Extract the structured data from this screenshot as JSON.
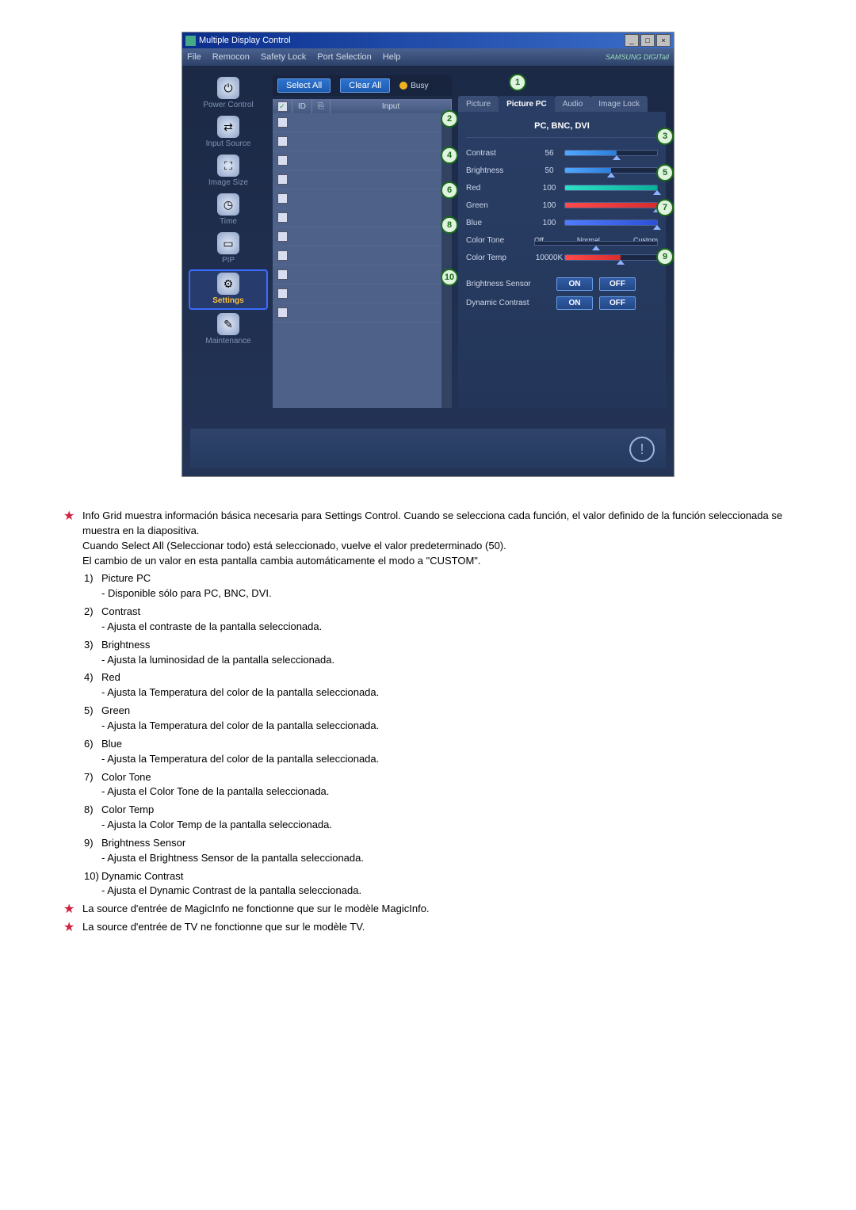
{
  "app": {
    "title": "Multiple Display Control",
    "brand": "SAMSUNG DIGITall",
    "menus": [
      "File",
      "Remocon",
      "Safety Lock",
      "Port Selection",
      "Help"
    ]
  },
  "sidebar": {
    "items": [
      {
        "label": "Power Control",
        "glyph": "⏻"
      },
      {
        "label": "Input Source",
        "glyph": "⇄"
      },
      {
        "label": "Image Size",
        "glyph": "⛶"
      },
      {
        "label": "Time",
        "glyph": "◷"
      },
      {
        "label": "PIP",
        "glyph": "▭"
      },
      {
        "label": "Settings",
        "glyph": "⚙",
        "selected": true
      },
      {
        "label": "Maintenance",
        "glyph": "✎"
      }
    ]
  },
  "toolbar": {
    "select_all": "Select All",
    "clear_all": "Clear All",
    "busy": "Busy"
  },
  "grid": {
    "headers": {
      "id": "ID",
      "input": "Input"
    },
    "rows": 11,
    "first_checked": true
  },
  "tabs": [
    "Picture",
    "Picture PC",
    "Audio",
    "Image Lock"
  ],
  "active_tab": "Picture PC",
  "panel": {
    "header": "PC, BNC, DVI",
    "contrast": {
      "label": "Contrast",
      "value": 56
    },
    "brightness": {
      "label": "Brightness",
      "value": 50
    },
    "red": {
      "label": "Red",
      "value": 100
    },
    "green": {
      "label": "Green",
      "value": 100
    },
    "blue": {
      "label": "Blue",
      "value": 100
    },
    "color_tone": {
      "label": "Color Tone",
      "opts": [
        "Off",
        "Normal",
        "Custom"
      ]
    },
    "color_temp": {
      "label": "Color Temp",
      "value": "10000K"
    },
    "brightness_sensor": {
      "label": "Brightness Sensor",
      "on": "ON",
      "off": "OFF"
    },
    "dynamic_contrast": {
      "label": "Dynamic Contrast",
      "on": "ON",
      "off": "OFF"
    }
  },
  "callouts": [
    "1",
    "2",
    "3",
    "4",
    "5",
    "6",
    "7",
    "8",
    "9",
    "10"
  ],
  "desc": {
    "star1_l1": "Info Grid muestra información básica necesaria para Settings Control. Cuando se selecciona cada función, el valor definido de la función seleccionada se muestra en la diapositiva.",
    "star1_l2": "Cuando Select All (Seleccionar todo) está seleccionado, vuelve el valor predeterminado (50).",
    "star1_l3": "El cambio de un valor en esta pantalla cambia automáticamente el modo a \"CUSTOM\".",
    "items": [
      {
        "n": "1)",
        "t": "Picture PC",
        "s": "- Disponible sólo para PC, BNC, DVI."
      },
      {
        "n": "2)",
        "t": "Contrast",
        "s": "- Ajusta el contraste de la pantalla seleccionada."
      },
      {
        "n": "3)",
        "t": "Brightness",
        "s": "- Ajusta la luminosidad de la pantalla seleccionada."
      },
      {
        "n": "4)",
        "t": "Red",
        "s": "- Ajusta la Temperatura del color de la pantalla seleccionada."
      },
      {
        "n": "5)",
        "t": "Green",
        "s": "- Ajusta la Temperatura del color de la pantalla seleccionada."
      },
      {
        "n": "6)",
        "t": "Blue",
        "s": "- Ajusta la Temperatura del color de la pantalla seleccionada."
      },
      {
        "n": "7)",
        "t": "Color Tone",
        "s": "- Ajusta el Color Tone de la pantalla seleccionada."
      },
      {
        "n": "8)",
        "t": "Color Temp",
        "s": "- Ajusta la Color Temp de la pantalla seleccionada."
      },
      {
        "n": "9)",
        "t": "Brightness Sensor",
        "s": "- Ajusta el Brightness Sensor de la pantalla seleccionada."
      },
      {
        "n": "10)",
        "t": "Dynamic Contrast",
        "s": "- Ajusta el Dynamic Contrast de la pantalla seleccionada."
      }
    ],
    "star2": "La source d'entrée de MagicInfo ne fonctionne que sur le modèle MagicInfo.",
    "star3": "La source d'entrée de TV ne fonctionne que sur le modèle TV."
  }
}
